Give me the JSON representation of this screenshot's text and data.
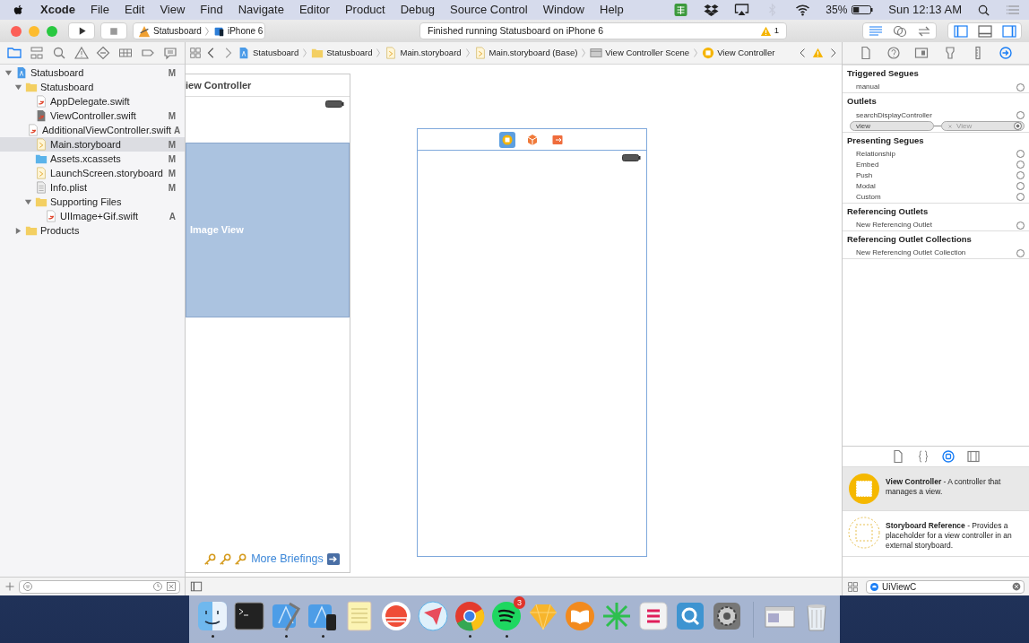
{
  "menubar": {
    "app": "Xcode",
    "menus": [
      "File",
      "Edit",
      "View",
      "Find",
      "Navigate",
      "Editor",
      "Product",
      "Debug",
      "Source Control",
      "Window",
      "Help"
    ],
    "status_icons": [
      {
        "kind": "grid-app",
        "disabled": false
      },
      {
        "kind": "box",
        "disabled": false
      },
      {
        "kind": "airplay",
        "disabled": false
      },
      {
        "kind": "bluetooth",
        "disabled": true
      },
      {
        "kind": "wifi",
        "disabled": false
      }
    ],
    "battery": "35%",
    "battery_level": {
      "level": 0.35
    },
    "clock": "Sun 12:13 AM"
  },
  "toolbar": {
    "scheme": "Statusboard",
    "device": "iPhone 6",
    "activity": "Finished running Statusboard on iPhone 6",
    "warnings": "1",
    "editor_modes": [
      {
        "kind": "standard",
        "selected": true
      },
      {
        "kind": "assistant",
        "selected": false
      },
      {
        "kind": "version",
        "selected": false
      }
    ],
    "panels": [
      {
        "kind": "left",
        "on": true
      },
      {
        "kind": "bottom",
        "on": false
      },
      {
        "kind": "right",
        "on": true
      }
    ]
  },
  "navigator": {
    "tabs": [
      {
        "kind": "folder",
        "selected": true
      },
      {
        "kind": "hierarchy",
        "selected": false
      },
      {
        "kind": "search",
        "selected": false
      },
      {
        "kind": "warning",
        "selected": false
      },
      {
        "kind": "diamond",
        "selected": false
      },
      {
        "kind": "tests",
        "selected": false
      },
      {
        "kind": "tag",
        "selected": false
      },
      {
        "kind": "chat",
        "selected": false
      }
    ],
    "tree": [
      {
        "label": "Statusboard",
        "kind": "project",
        "badge": "M",
        "expanded": true,
        "selected": false,
        "children": [
          {
            "label": "Statusboard",
            "kind": "folder",
            "expanded": true,
            "selected": false,
            "children": [
              {
                "label": "AppDelegate.swift",
                "kind": "swift",
                "selected": false
              },
              {
                "label": "ViewController.swift",
                "kind": "swift-dark",
                "badge": "M",
                "selected": false
              },
              {
                "label": "AdditionalViewController.swift",
                "kind": "swift",
                "badge": "A",
                "selected": false
              },
              {
                "label": "Main.storyboard",
                "kind": "storyboard",
                "badge": "M",
                "selected": true
              },
              {
                "label": "Assets.xcassets",
                "kind": "assets",
                "badge": "M",
                "selected": false
              },
              {
                "label": "LaunchScreen.storyboard",
                "kind": "storyboard",
                "badge": "M",
                "selected": false
              },
              {
                "label": "Info.plist",
                "kind": "plist",
                "badge": "M",
                "selected": false
              },
              {
                "label": "Supporting Files",
                "kind": "folder",
                "expanded": true,
                "selected": false,
                "children": [
                  {
                    "label": "UIImage+Gif.swift",
                    "kind": "swift",
                    "badge": "A",
                    "selected": false
                  }
                ]
              }
            ]
          },
          {
            "label": "Products",
            "kind": "folder",
            "expanded": false,
            "selected": false
          }
        ]
      }
    ]
  },
  "jump_bar": [
    {
      "label": "Statusboard",
      "kind": "project"
    },
    {
      "label": "Statusboard",
      "kind": "folder"
    },
    {
      "label": "Main.storyboard",
      "kind": "storyboard"
    },
    {
      "label": "Main.storyboard (Base)",
      "kind": "storyboard"
    },
    {
      "label": "View Controller Scene",
      "kind": "scene"
    },
    {
      "label": "View Controller",
      "kind": "controller"
    }
  ],
  "canvas": {
    "scene_1": {
      "title": "iew Controller",
      "image_view": "Image View",
      "link": "More Briefings"
    },
    "scene_2": {
      "dock_icons": [
        {
          "kind": "controller",
          "selected": true
        },
        {
          "kind": "cube",
          "selected": false
        },
        {
          "kind": "exit",
          "selected": false
        }
      ]
    }
  },
  "inspector": {
    "tabs": [
      {
        "kind": "file",
        "selected": false
      },
      {
        "kind": "help",
        "selected": false
      },
      {
        "kind": "identity",
        "selected": false
      },
      {
        "kind": "attributes",
        "selected": false
      },
      {
        "kind": "size",
        "selected": false
      },
      {
        "kind": "connections",
        "selected": true
      }
    ],
    "sections": [
      {
        "title": "Triggered Segues",
        "rows": [
          {
            "label": "manual",
            "connected": false
          }
        ]
      },
      {
        "title": "Outlets",
        "rows": [
          {
            "label": "searchDisplayController",
            "connected": false
          },
          {
            "label": "view",
            "connected": true,
            "target": "View"
          }
        ]
      },
      {
        "title": "Presenting Segues",
        "rows": [
          {
            "label": "Relationship",
            "connected": false
          },
          {
            "label": "Embed",
            "connected": false
          },
          {
            "label": "Push",
            "connected": false
          },
          {
            "label": "Modal",
            "connected": false
          },
          {
            "label": "Custom",
            "connected": false
          }
        ]
      },
      {
        "title": "Referencing Outlets",
        "rows": [
          {
            "label": "New Referencing Outlet",
            "connected": false
          }
        ]
      },
      {
        "title": "Referencing Outlet Collections",
        "rows": [
          {
            "label": "New Referencing Outlet Collection",
            "connected": false
          }
        ]
      }
    ]
  },
  "library": {
    "tabs": [
      {
        "kind": "file",
        "selected": false
      },
      {
        "kind": "braces",
        "selected": false
      },
      {
        "kind": "object",
        "selected": true
      },
      {
        "kind": "media",
        "selected": false
      }
    ],
    "items": [
      {
        "kind": "controller",
        "text": "**View Controller** - A controller that manages a view.",
        "selected": true
      },
      {
        "kind": "reference",
        "text": "**Storyboard Reference** - Provides a placeholder for a view controller in an external storyboard.",
        "selected": false
      }
    ],
    "search": "UiViewC"
  },
  "dock": [
    {
      "kind": "finder",
      "running": true
    },
    {
      "kind": "terminal",
      "running": false
    },
    {
      "kind": "xcode",
      "running": true
    },
    {
      "kind": "simulator",
      "running": true
    },
    {
      "kind": "notes",
      "running": false
    },
    {
      "kind": "sunrise",
      "running": false
    },
    {
      "kind": "mail",
      "running": false
    },
    {
      "kind": "browser",
      "running": true
    },
    {
      "kind": "music",
      "running": true,
      "badge": "3"
    },
    {
      "kind": "gem",
      "running": false
    },
    {
      "kind": "book",
      "running": false
    },
    {
      "kind": "burst",
      "running": false
    },
    {
      "kind": "chat",
      "running": false
    },
    {
      "kind": "player",
      "running": false
    },
    {
      "kind": "gear",
      "running": false
    },
    {
      "kind": "separator"
    },
    {
      "kind": "window",
      "running": false
    },
    {
      "kind": "trash",
      "running": false
    }
  ]
}
